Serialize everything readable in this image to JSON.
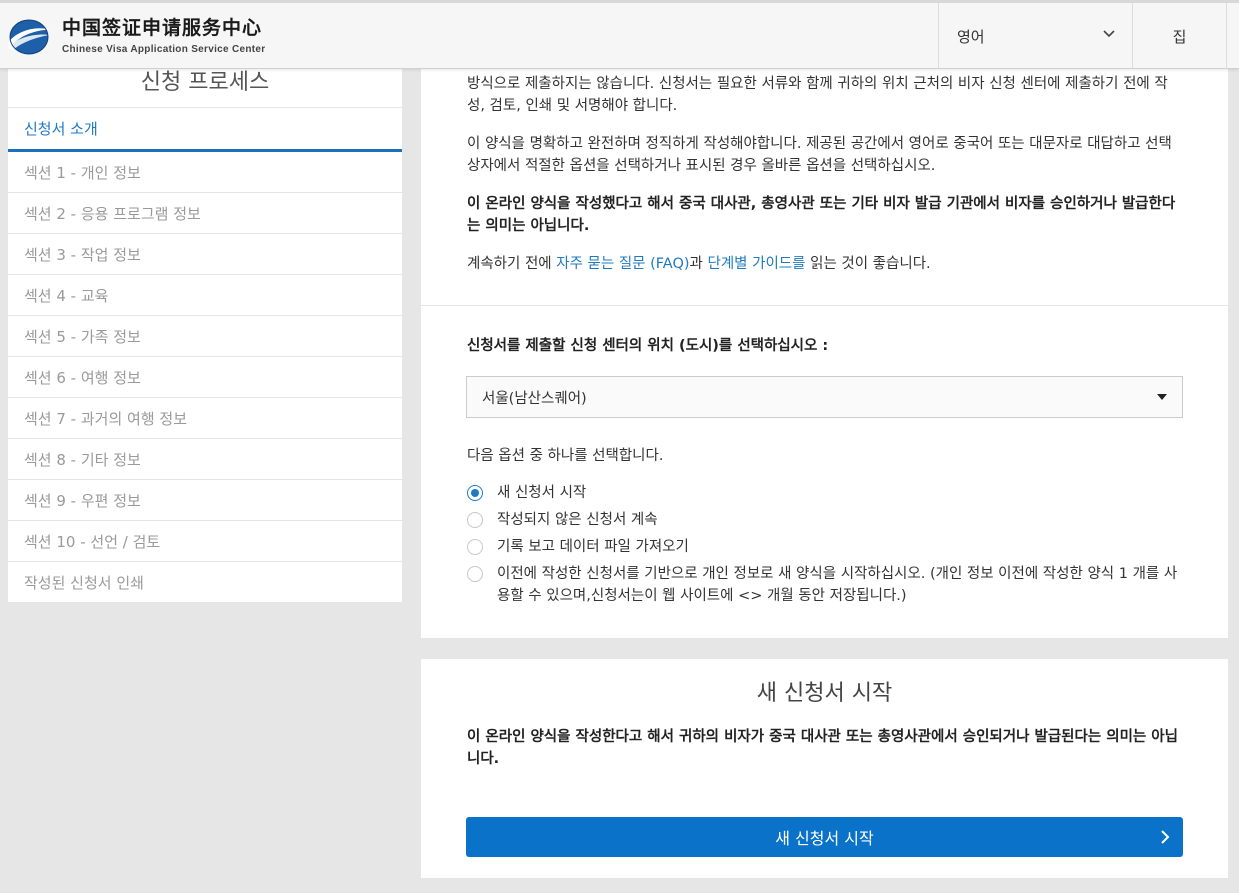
{
  "header": {
    "brand_cn": "中国签证申请服务中心",
    "brand_en": "Chinese Visa Application Service Center",
    "language": "영어",
    "home": "집"
  },
  "sidebar": {
    "title": "신청 프로세스",
    "items": [
      {
        "label": "신청서 소개",
        "active": true
      },
      {
        "label": "섹션 1 - 개인 정보"
      },
      {
        "label": "섹션 2 - 응용 프로그램 정보"
      },
      {
        "label": "섹션 3 - 작업 정보"
      },
      {
        "label": "섹션 4 - 교육"
      },
      {
        "label": "섹션 5 - 가족 정보"
      },
      {
        "label": "섹션 6 - 여행 정보"
      },
      {
        "label": "섹션 7 - 과거의 여행 정보"
      },
      {
        "label": "섹션 8 - 기타 정보"
      },
      {
        "label": "섹션 9 - 우편 정보"
      },
      {
        "label": "섹션 10 - 선언 / 검토"
      },
      {
        "label": "작성된 신청서 인쇄"
      }
    ]
  },
  "intro": {
    "para1": "방식으로 제출하지는 않습니다. 신청서는 필요한 서류와 함께 귀하의 위치 근처의 비자 신청 센터에 제출하기 전에 작성, 검토, 인쇄 및 서명해야 합니다.",
    "para2": "이 양식을 명확하고 완전하며 정직하게 작성해야합니다. 제공된 공간에서 영어로 중국어 또는 대문자로 대답하고 선택 상자에서 적절한 옵션을 선택하거나 표시된 경우 올바른 옵션을 선택하십시오.",
    "para3": "이 온라인 양식을 작성했다고 해서 중국 대사관, 총영사관 또는 기타 비자 발급 기관에서 비자를 승인하거나 발급한다는 의미는 아닙니다.",
    "para4_prefix": "계속하기 전에 ",
    "faq_link": "자주 묻는 질문 (FAQ)",
    "para4_mid": "과 ",
    "guide_link": "단계별 가이드를",
    "para4_suffix": " 읽는 것이 좋습니다."
  },
  "location": {
    "label": "신청서를 제출할 신청 센터의 위치 (도시)를 선택하십시오 :",
    "selected": "서울(남산스퀘어)"
  },
  "options": {
    "label": "다음 옵션 중 하나를 선택합니다.",
    "items": [
      {
        "label": "새 신청서 시작",
        "checked": true
      },
      {
        "label": "작성되지 않은 신청서 계속",
        "checked": false
      },
      {
        "label": "기록 보고 데이터 파일 가져오기",
        "checked": false
      },
      {
        "label": "이전에 작성한 신청서를 기반으로 개인 정보로 새 양식을 시작하십시오. (개인 정보 이전에 작성한 양식 1 개를 사용할 수 있으며,신청서는이 웹 사이트에 <> 개월 동안 저장됩니다.)",
        "checked": false
      }
    ]
  },
  "new_app": {
    "title": "새 신청서 시작",
    "notice": "이 온라인 양식을 작성한다고 해서 귀하의 비자가 중국 대사관 또는 총영사관에서 승인되거나 발급된다는 의미는 아닙니다.",
    "button": "새 신청서 시작"
  },
  "colors": {
    "accent": "#1f7ac2",
    "button": "#0b72c9"
  }
}
